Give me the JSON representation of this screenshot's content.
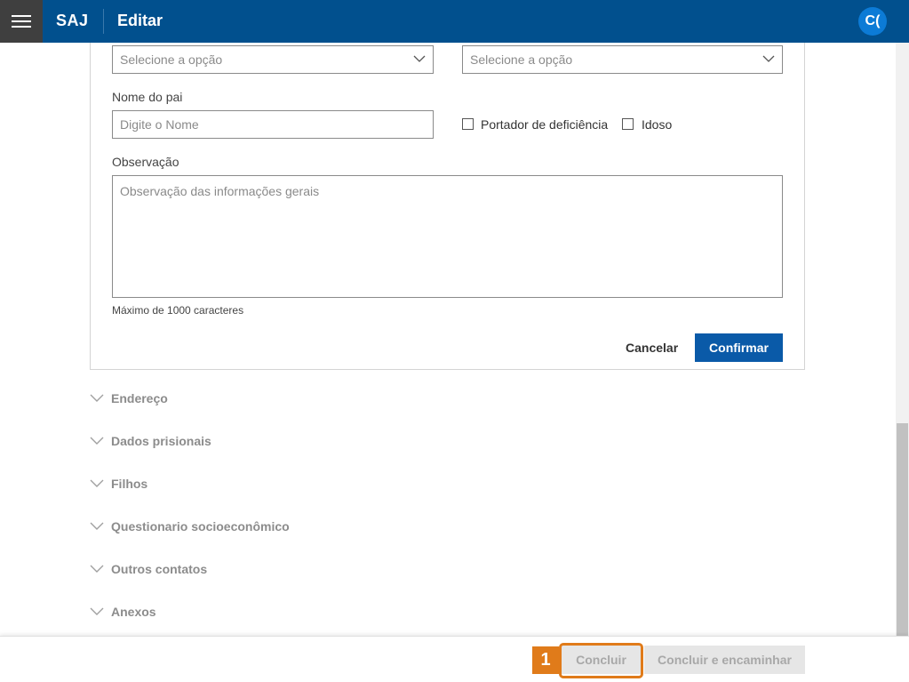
{
  "header": {
    "brand": "SAJ",
    "title": "Editar",
    "avatar_initials": "C("
  },
  "form": {
    "select_left_placeholder": "Selecione a opção",
    "select_right_placeholder": "Selecione a opção",
    "father_name_label": "Nome do pai",
    "father_name_placeholder": "Digite o Nome",
    "disability_label": "Portador de deficiência",
    "elderly_label": "Idoso",
    "observation_label": "Observação",
    "observation_placeholder": "Observação das informações gerais",
    "max_chars_hint": "Máximo de 1000 caracteres",
    "cancel_label": "Cancelar",
    "confirm_label": "Confirmar"
  },
  "sections": [
    {
      "label": "Endereço"
    },
    {
      "label": "Dados prisionais"
    },
    {
      "label": "Filhos"
    },
    {
      "label": "Questionario socioeconômico"
    },
    {
      "label": "Outros contatos"
    },
    {
      "label": "Anexos"
    }
  ],
  "footer": {
    "conclude_label": "Concluir",
    "conclude_forward_label": "Concluir e encaminhar",
    "step_number": "1"
  },
  "colors": {
    "header_bg": "#01508e",
    "primary_button": "#0a5aa8",
    "highlight": "#e07b1a",
    "avatar": "#0c7bd6"
  }
}
